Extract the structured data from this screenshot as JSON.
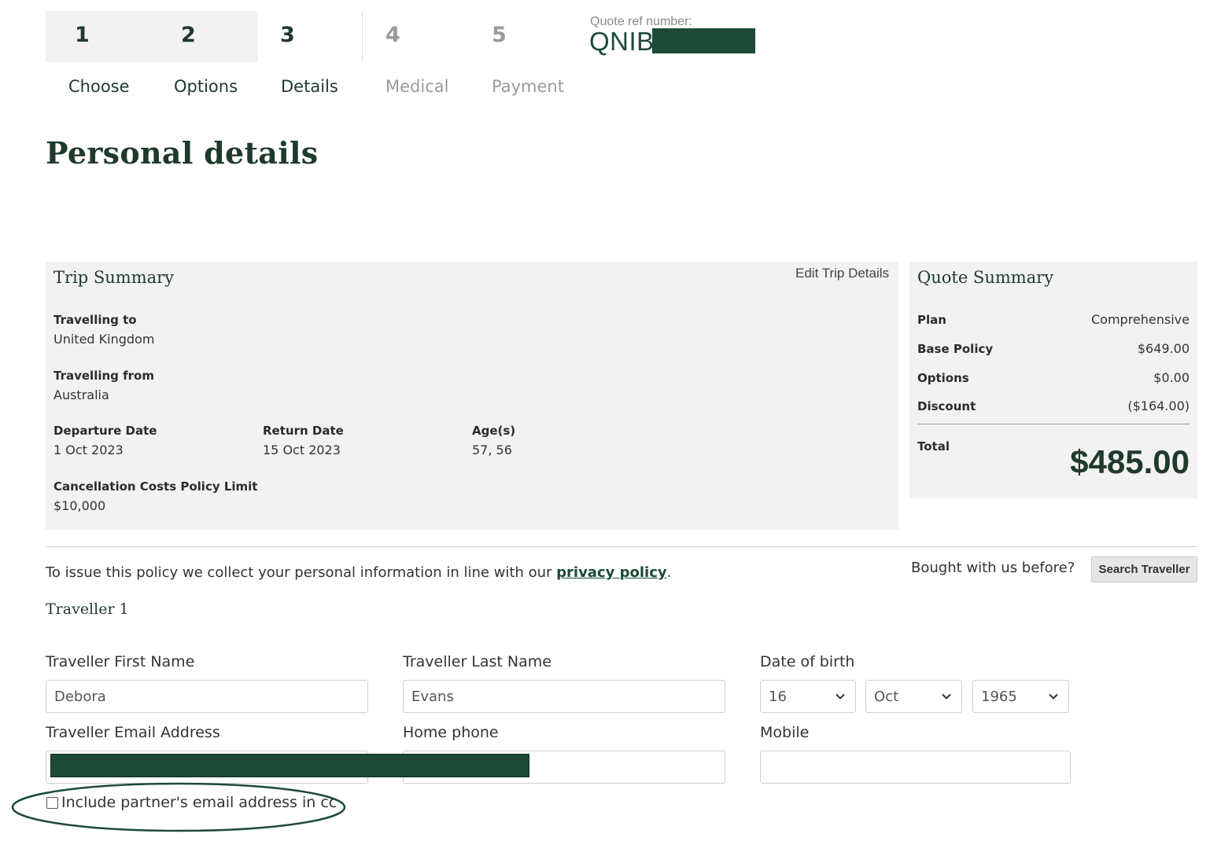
{
  "stepper": {
    "steps": [
      {
        "num": "1",
        "label": "Choose"
      },
      {
        "num": "2",
        "label": "Options"
      },
      {
        "num": "3",
        "label": "Details"
      },
      {
        "num": "4",
        "label": "Medical"
      },
      {
        "num": "5",
        "label": "Payment"
      }
    ]
  },
  "quote_ref": {
    "label": "Quote ref number:",
    "prefix": "QNIB"
  },
  "page_title": "Personal details",
  "trip_summary": {
    "title": "Trip Summary",
    "edit_link": "Edit Trip Details",
    "travelling_to": {
      "label": "Travelling to",
      "value": "United Kingdom"
    },
    "travelling_from": {
      "label": "Travelling from",
      "value": "Australia"
    },
    "departure": {
      "label": "Departure Date",
      "value": "1 Oct 2023"
    },
    "return": {
      "label": "Return Date",
      "value": "15 Oct 2023"
    },
    "ages": {
      "label": "Age(s)",
      "value": "57, 56"
    },
    "cancellation": {
      "label": "Cancellation Costs Policy Limit",
      "value": "$10,000"
    }
  },
  "quote_summary": {
    "title": "Quote Summary",
    "rows": [
      {
        "label": "Plan",
        "value": "Comprehensive"
      },
      {
        "label": "Base Policy",
        "value": "$649.00"
      },
      {
        "label": "Options",
        "value": "$0.00"
      },
      {
        "label": "Discount",
        "value": "($164.00)"
      }
    ],
    "total_label": "Total",
    "total_value": "$485.00"
  },
  "privacy": {
    "text": "To issue this policy we collect your personal information in line with our ",
    "link": "privacy policy",
    "suffix": "."
  },
  "bought_before": {
    "text": "Bought with us before?",
    "button": "Search Traveller"
  },
  "traveller": {
    "heading": "Traveller 1",
    "first_name": {
      "label": "Traveller First Name",
      "value": "Debora"
    },
    "last_name": {
      "label": "Traveller Last Name",
      "value": "Evans"
    },
    "dob": {
      "label": "Date of birth",
      "day": "16",
      "month": "Oct",
      "year": "1965"
    },
    "email": {
      "label": "Traveller Email Address",
      "value": ""
    },
    "home_phone": {
      "label": "Home phone",
      "value": ""
    },
    "mobile": {
      "label": "Mobile",
      "value": ""
    },
    "cc_checkbox": {
      "label": "Include partner's email address in cc",
      "checked": false
    }
  },
  "colors": {
    "brand_green": "#1d4a36",
    "panel_bg": "#f2f2f2",
    "annotation_oval": "#1d4a36"
  },
  "icons": [
    "chevron-down-icon"
  ]
}
